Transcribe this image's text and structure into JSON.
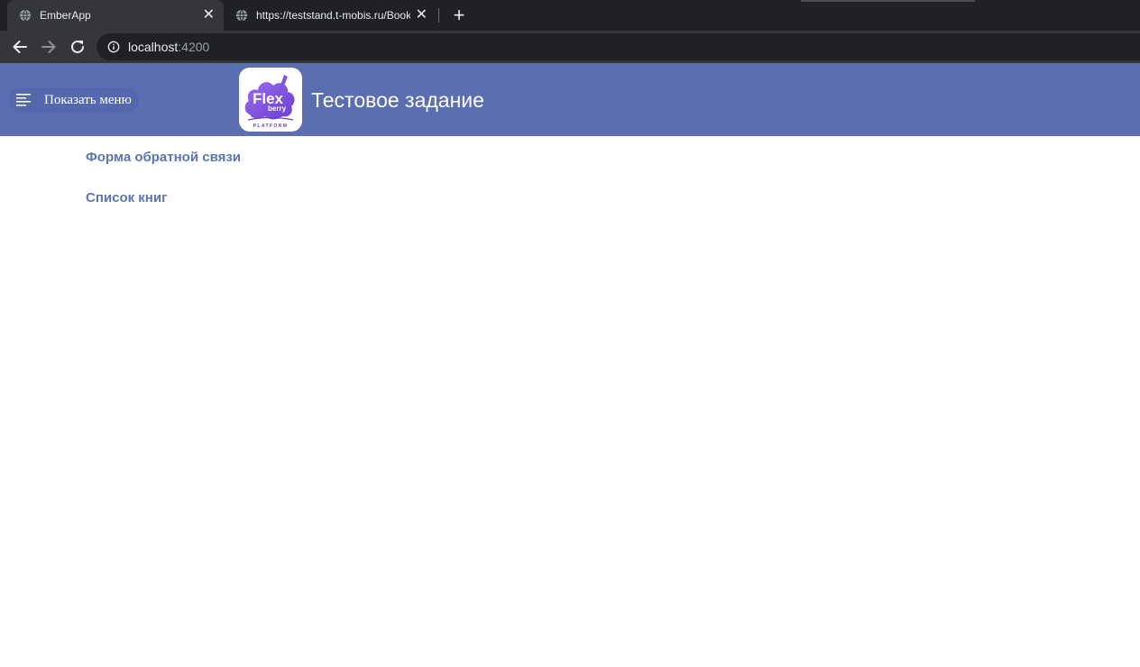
{
  "browser": {
    "tabs": [
      {
        "title": "EmberApp",
        "active": true,
        "icon": "globe-icon"
      },
      {
        "title": "https://teststand.t-mobis.ru/Book",
        "active": false,
        "icon": "globe-icon"
      }
    ],
    "close_glyph": "✕",
    "new_tab_glyph": "+",
    "address": {
      "host": "localhost",
      "port": ":4200"
    }
  },
  "header": {
    "menu_button_label": "Показать меню",
    "logo": {
      "word1": "Flex",
      "word2": "berry",
      "word3": "PLATFORM"
    },
    "title": "Тестовое задание",
    "background": "#5b6eb2"
  },
  "content": {
    "links": [
      {
        "label": "Форма обратной связи"
      },
      {
        "label": "Список книг"
      }
    ],
    "link_color": "#5b74b4"
  }
}
